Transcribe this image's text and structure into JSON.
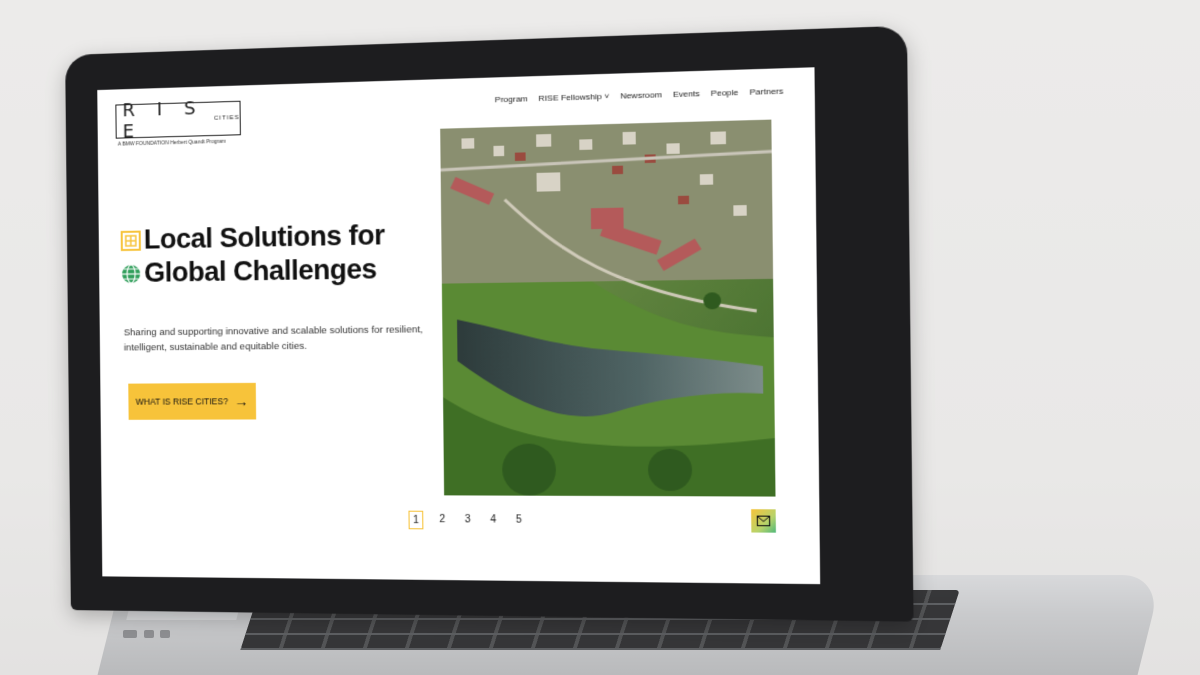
{
  "logo": {
    "letters": "R I S E",
    "cities": "CITIES",
    "tagline": "A BMW FOUNDATION Herbert Quandt Program"
  },
  "nav": [
    {
      "label": "Program"
    },
    {
      "label": "RISE Fellowship ˅"
    },
    {
      "label": "Newsroom"
    },
    {
      "label": "Events"
    },
    {
      "label": "People"
    },
    {
      "label": "Partners"
    }
  ],
  "hero": {
    "line1": "Local Solutions for",
    "line2": "Global Challenges",
    "subtitle": "Sharing and supporting innovative and scalable solutions for resilient, intelligent, sustainable and equitable cities.",
    "cta_label": "WHAT IS RISE CITIES?",
    "cta_icon": "arrow-right-icon"
  },
  "pager": {
    "pages": [
      "1",
      "2",
      "3",
      "4",
      "5"
    ],
    "active": "1"
  },
  "colors": {
    "accent": "#f7c33a",
    "green": "#2f9e5a",
    "text": "#111111"
  },
  "icons": [
    "building-icon",
    "globe-icon",
    "mail-icon"
  ]
}
